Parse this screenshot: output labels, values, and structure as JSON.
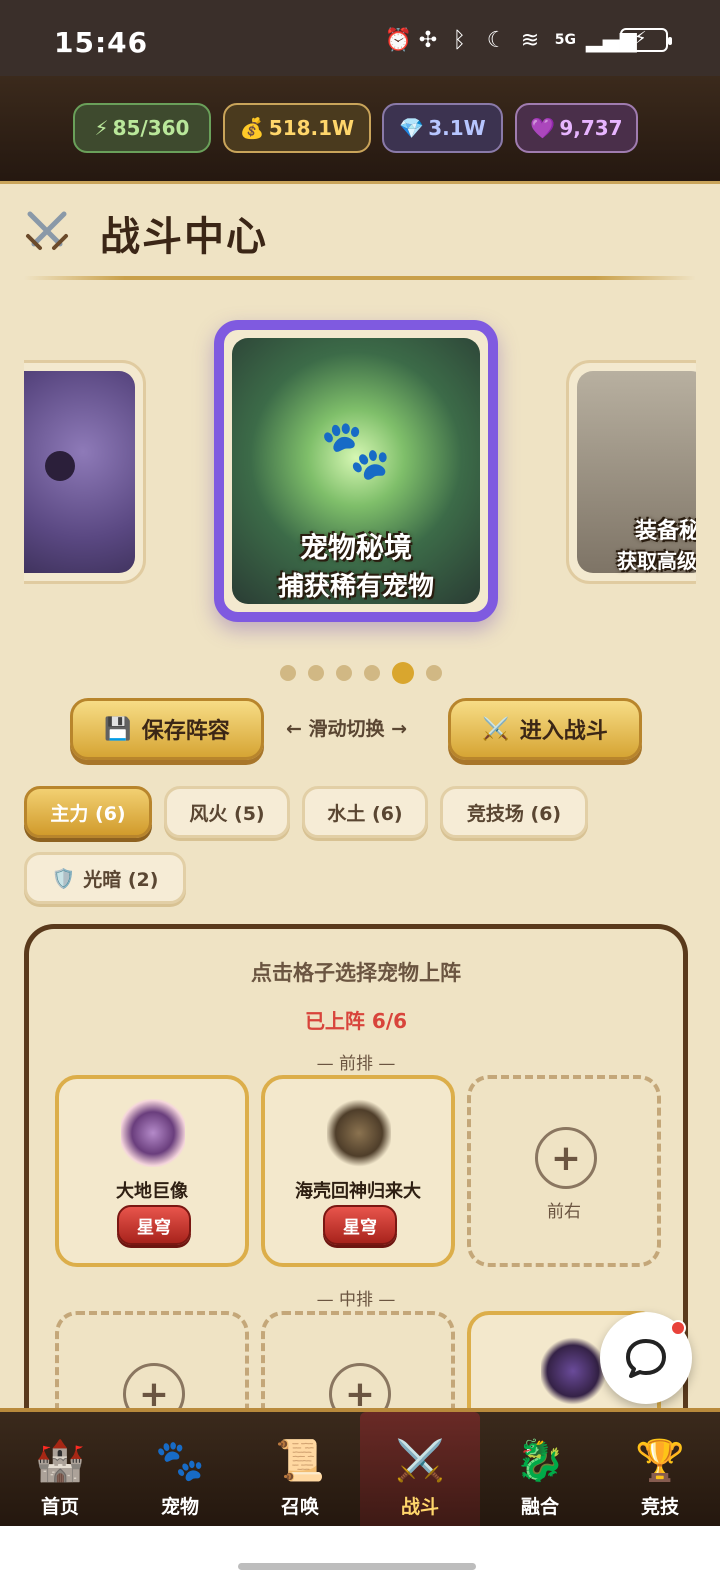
{
  "status_bar": {
    "time": "15:46",
    "network": "5G"
  },
  "resources": {
    "energy": "85/360",
    "gold": "518.1W",
    "diamond": "3.1W",
    "heart": "9,737"
  },
  "header": {
    "title": "战斗中心"
  },
  "carousel": {
    "center_card": {
      "title": "宠物秘境",
      "subtitle": "捕获稀有宠物"
    },
    "right_card": {
      "title": "装备秘",
      "subtitle": "获取高级"
    },
    "dot_count": 6,
    "active_dot": 5
  },
  "actions": {
    "save_label": "保存阵容",
    "swipe_hint": "← 滑动切换 →",
    "enter_label": "进入战斗"
  },
  "formation_tabs": [
    {
      "label": "主力 (6)",
      "active": true
    },
    {
      "label": "风火 (5)",
      "active": false
    },
    {
      "label": "水土 (6)",
      "active": false
    },
    {
      "label": "竞技场 (6)",
      "active": false
    },
    {
      "label": "光暗 (2)",
      "active": false,
      "icon": "shield-icon"
    }
  ],
  "panel": {
    "hint": "点击格子选择宠物上阵",
    "count": "已上阵 6/6",
    "front_row_label": "— 前排 —",
    "mid_row_label": "— 中排 —",
    "slots": [
      {
        "name": "大地巨像",
        "rank": "星穹"
      },
      {
        "name": "海壳回神归来大",
        "rank": "星穹"
      },
      {
        "empty_label": "前右"
      }
    ]
  },
  "bottom_nav": [
    {
      "label": "首页",
      "icon": "castle-icon"
    },
    {
      "label": "宠物",
      "icon": "paw-icon"
    },
    {
      "label": "召唤",
      "icon": "scroll-icon"
    },
    {
      "label": "战斗",
      "icon": "swords-icon",
      "active": true
    },
    {
      "label": "融合",
      "icon": "dragon-icon"
    },
    {
      "label": "竞技",
      "icon": "trophy-icon"
    }
  ],
  "colors": {
    "accent_purple": "#7f5ae0",
    "gold": "#d6a534",
    "rank_red": "#d8443b"
  }
}
